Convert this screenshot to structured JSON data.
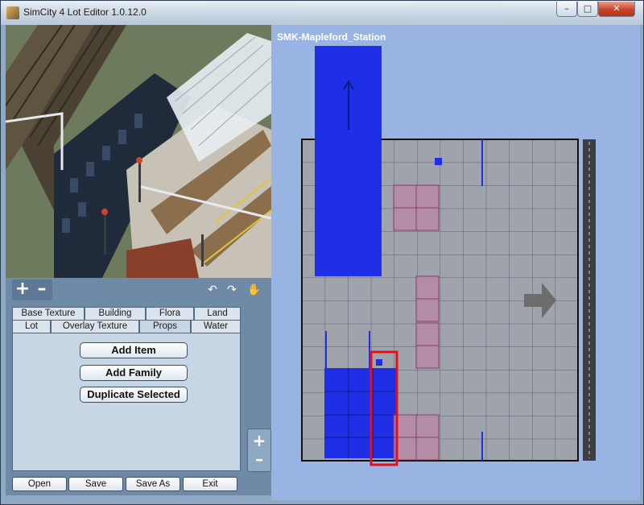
{
  "window": {
    "title": "SimCity 4 Lot Editor 1.0.12.0"
  },
  "window_controls": {
    "minimize": "–",
    "maximize": "□",
    "close": "✕"
  },
  "editor": {
    "lot_name": "SMK-Mapleford_Station"
  },
  "zoom": {
    "plus": "+",
    "minus": "–"
  },
  "rotation": {
    "ccw": "↶",
    "cw": "↷",
    "hand": "✋"
  },
  "tabs": {
    "back": [
      "Base Texture",
      "Building",
      "Flora",
      "Land"
    ],
    "front": [
      "Lot",
      "Overlay Texture",
      "Props",
      "Water"
    ],
    "active": "Props"
  },
  "actions": {
    "add_item": "Add Item",
    "add_family": "Add Family",
    "duplicate": "Duplicate Selected"
  },
  "bottom": {
    "open": "Open",
    "save": "Save",
    "save_as": "Save As",
    "exit": "Exit"
  },
  "side_zoom": {
    "plus": "+",
    "minus": "–"
  },
  "colors": {
    "building_footprint": "#1f2fe6",
    "selection": "#e3101b",
    "lot_background": "#99b4e3"
  }
}
